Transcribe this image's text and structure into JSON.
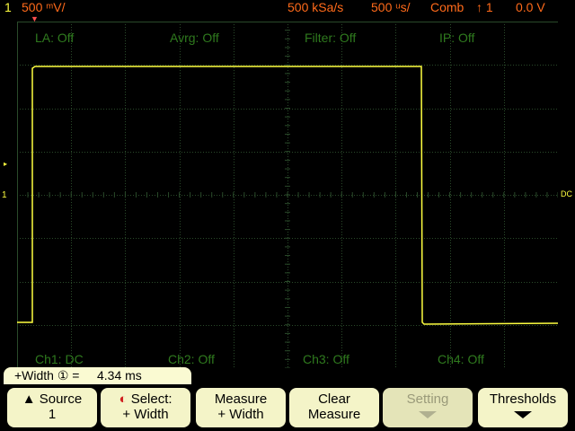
{
  "status_bar": {
    "channel": "1",
    "volts_per_div": "500 ᵐV/",
    "sample_rate": "500 kSa/s",
    "time_per_div": "500 ᵘs/",
    "acq_mode": "Comb",
    "trigger_symbol": "↑ 1",
    "trigger_level": "0.0 V"
  },
  "overlay_labels": {
    "la": "LA: Off",
    "avrg": "Avrg: Off",
    "filter": "Filter: Off",
    "ip": "IP: Off",
    "ch1": "Ch1: DC",
    "ch2": "Ch2: Off",
    "ch3": "Ch3: Off",
    "ch4": "Ch4: Off"
  },
  "markers": {
    "ground": "1",
    "right": "DC"
  },
  "measurement": {
    "label": "+Width ① =",
    "value": "4.34 ms"
  },
  "softkeys": [
    {
      "line1": "▲ Source",
      "line2": "1"
    },
    {
      "line1": "Select:",
      "line2": "+ Width"
    },
    {
      "line1": "Measure",
      "line2": "+ Width"
    },
    {
      "line1": "Clear",
      "line2": "Measure"
    },
    {
      "line1": "Setting",
      "line2": ""
    },
    {
      "line1": "Thresholds",
      "line2": ""
    }
  ],
  "colors": {
    "trace": "#ffff40",
    "grid": "#2a4a2a",
    "status_text": "#ff6a1a",
    "softkey_bg": "#f4f4c8"
  }
}
